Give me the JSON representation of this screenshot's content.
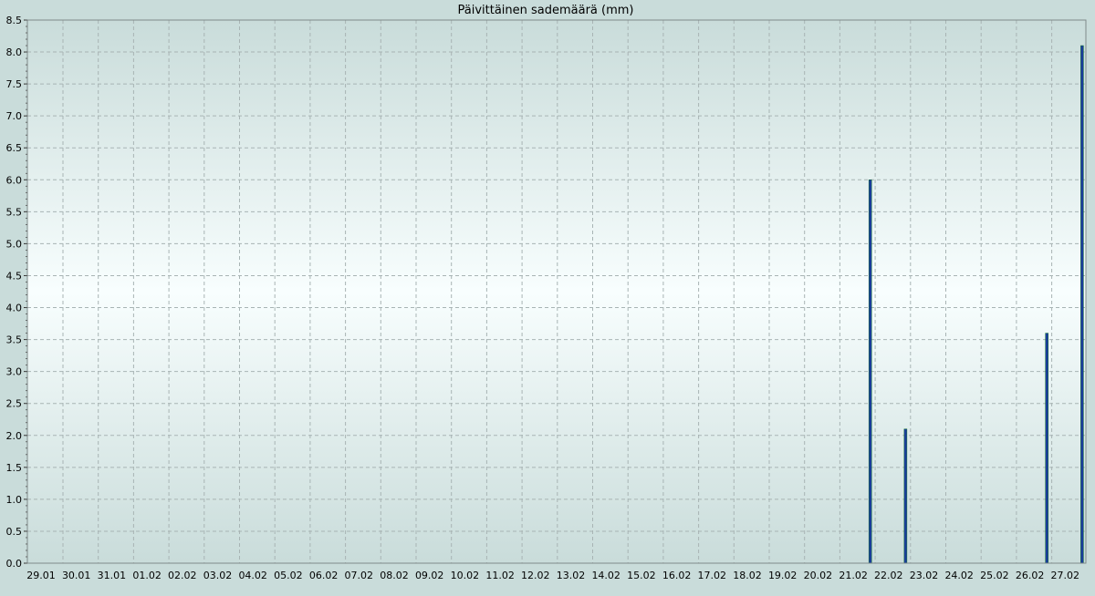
{
  "chart_data": {
    "type": "bar",
    "title": "Päivittäinen sademäärä (mm)",
    "xlabel": "",
    "ylabel": "",
    "ylim": [
      0,
      8.5
    ],
    "y_ticks": [
      "0.0",
      "0.5",
      "1.0",
      "1.5",
      "2.0",
      "2.5",
      "3.0",
      "3.5",
      "4.0",
      "4.5",
      "5.0",
      "5.5",
      "6.0",
      "6.5",
      "7.0",
      "7.5",
      "8.0",
      "8.5"
    ],
    "categories": [
      "29.01",
      "30.01",
      "31.01",
      "01.02",
      "02.02",
      "03.02",
      "04.02",
      "05.02",
      "06.02",
      "07.02",
      "08.02",
      "09.02",
      "10.02",
      "11.02",
      "12.02",
      "13.02",
      "14.02",
      "15.02",
      "16.02",
      "17.02",
      "18.02",
      "19.02",
      "20.02",
      "21.02",
      "22.02",
      "23.02",
      "24.02",
      "25.02",
      "26.02",
      "27.02"
    ],
    "values": [
      0,
      0,
      0,
      0,
      0,
      0,
      0,
      0,
      0,
      0,
      0,
      0,
      0,
      0,
      0,
      0,
      0,
      0,
      0,
      0,
      0,
      0,
      0,
      6.0,
      2.1,
      0,
      0,
      0,
      3.6,
      8.1
    ],
    "grid": true,
    "colors": {
      "bar_fill": "#1a3c9c",
      "bar_edge": "#0a6a2a",
      "grid": "#a8b4b4",
      "frame": "#7f8a8a",
      "bg_edge": "#c9dcda",
      "bg_center": "#f8fefe"
    }
  }
}
